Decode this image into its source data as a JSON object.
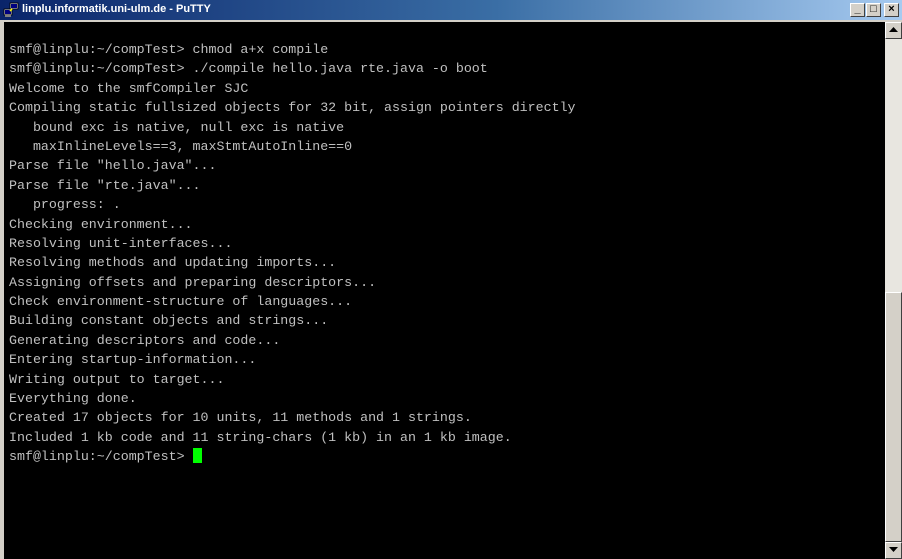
{
  "window": {
    "title": "linplu.informatik.uni-ulm.de - PuTTY",
    "controls": {
      "minimize": "_",
      "maximize": "□",
      "close": "×"
    }
  },
  "terminal": {
    "lines": [
      "smf@linplu:~/compTest> chmod a+x compile",
      "smf@linplu:~/compTest> ./compile hello.java rte.java -o boot",
      "Welcome to the smfCompiler SJC",
      "Compiling static fullsized objects for 32 bit, assign pointers directly",
      "   bound exc is native, null exc is native",
      "   maxInlineLevels==3, maxStmtAutoInline==0",
      "Parse file \"hello.java\"...",
      "Parse file \"rte.java\"...",
      "   progress: .",
      "Checking environment...",
      "Resolving unit-interfaces...",
      "Resolving methods and updating imports...",
      "Assigning offsets and preparing descriptors...",
      "Check environment-structure of languages...",
      "Building constant objects and strings...",
      "Generating descriptors and code...",
      "Entering startup-information...",
      "Writing output to target...",
      "Everything done.",
      "Created 17 objects for 10 units, 11 methods and 1 strings.",
      "Included 1 kb code and 11 string-chars (1 kb) in an 1 kb image."
    ],
    "prompt": "smf@linplu:~/compTest> ",
    "cursor_color": "#00ff00",
    "text_color": "#c0c0c0",
    "background": "#000000"
  }
}
